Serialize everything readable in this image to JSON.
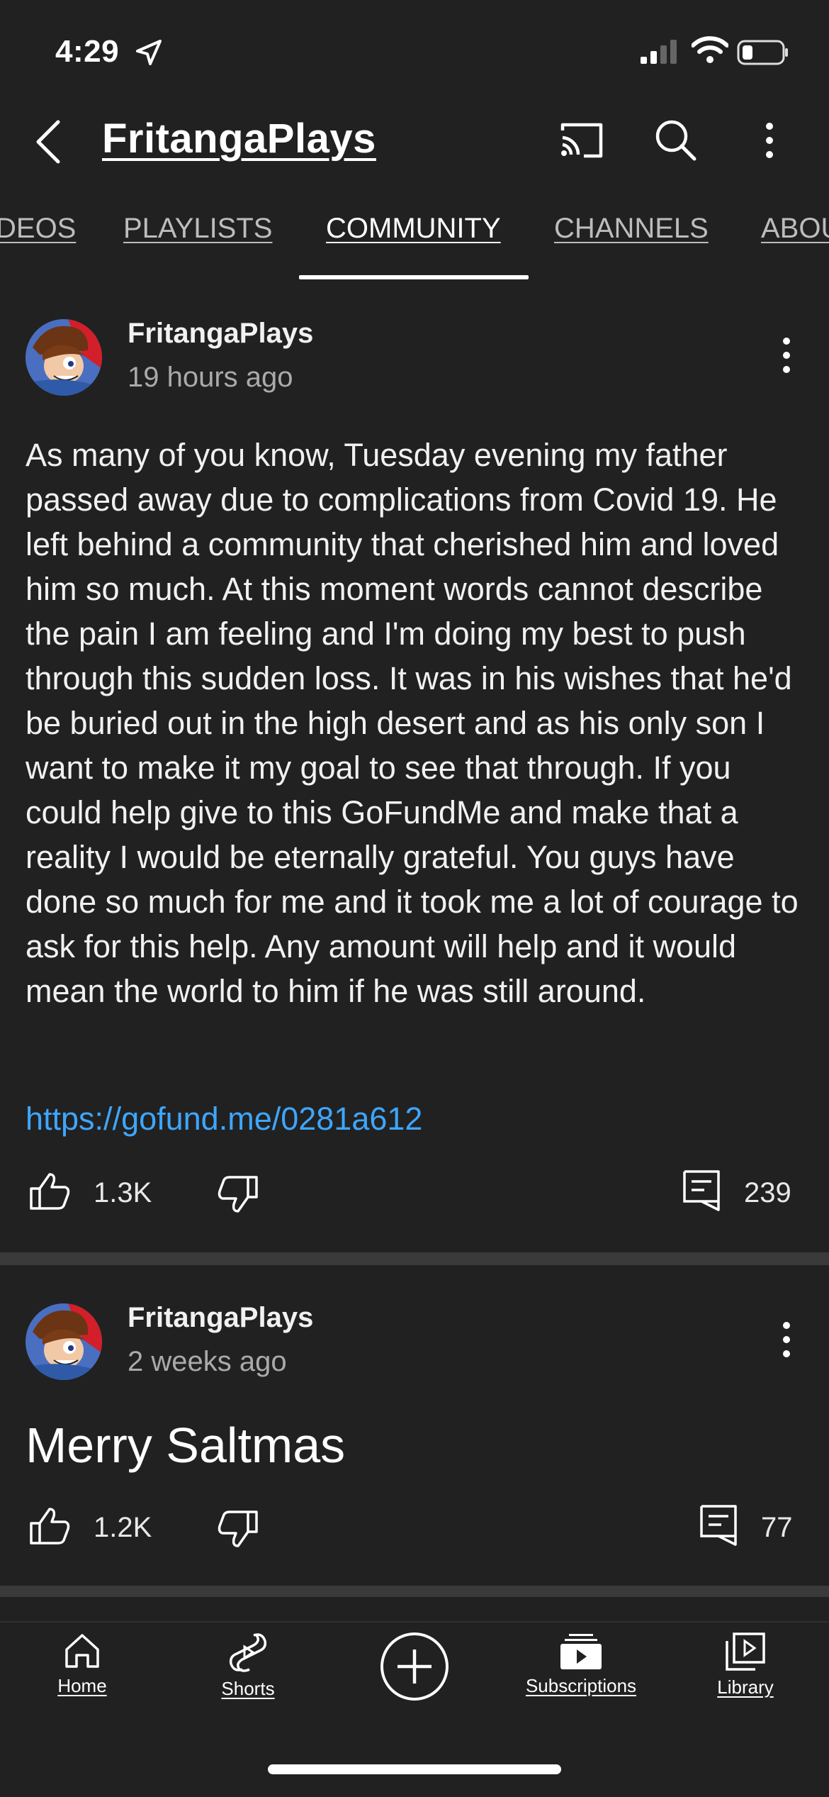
{
  "status_bar": {
    "time": "4:29",
    "icons": [
      "location-arrow-icon",
      "signal-icon",
      "wifi-icon",
      "battery-icon"
    ]
  },
  "header": {
    "channel_name": "FritangaPlays",
    "icons": [
      "back-icon",
      "cast-icon",
      "search-icon",
      "more-vert-icon"
    ]
  },
  "tabs": [
    {
      "label": "DEOS",
      "active": false
    },
    {
      "label": "PLAYLISTS",
      "active": false
    },
    {
      "label": "COMMUNITY",
      "active": true
    },
    {
      "label": "CHANNELS",
      "active": false
    },
    {
      "label": "ABOU",
      "active": false
    }
  ],
  "posts": [
    {
      "author": "FritangaPlays",
      "time": "19 hours ago",
      "body": "As many of you know, Tuesday evening my father passed away due to complications from Covid 19. He left behind a community that cherished him and loved him so much. At this moment words cannot describe the pain I am feeling and I'm doing my best to push through this sudden loss. It was in his wishes that he'd be buried out in the high desert and as his only son I want to make it my goal to see that through. If you could help give to this GoFundMe and make that a reality I would be eternally grateful. You guys have done so much for me and it took me a lot of courage to ask for this help. Any amount will help and it would mean the world to him if he was still around.",
      "link": "https://gofund.me/0281a612",
      "likes": "1.3K",
      "comments": "239"
    },
    {
      "author": "FritangaPlays",
      "time": "2 weeks ago",
      "body": "Merry Saltmas",
      "likes": "1.2K",
      "comments": "77"
    }
  ],
  "bottom_nav": [
    {
      "label": "Home",
      "icon": "home-icon"
    },
    {
      "label": "Shorts",
      "icon": "shorts-icon"
    },
    {
      "label": "",
      "icon": "create-plus-icon"
    },
    {
      "label": "Subscriptions",
      "icon": "subscriptions-icon"
    },
    {
      "label": "Library",
      "icon": "library-icon"
    }
  ],
  "colors": {
    "background": "#212121",
    "link": "#3ea6ff",
    "secondary_text": "#aaaaaa"
  }
}
